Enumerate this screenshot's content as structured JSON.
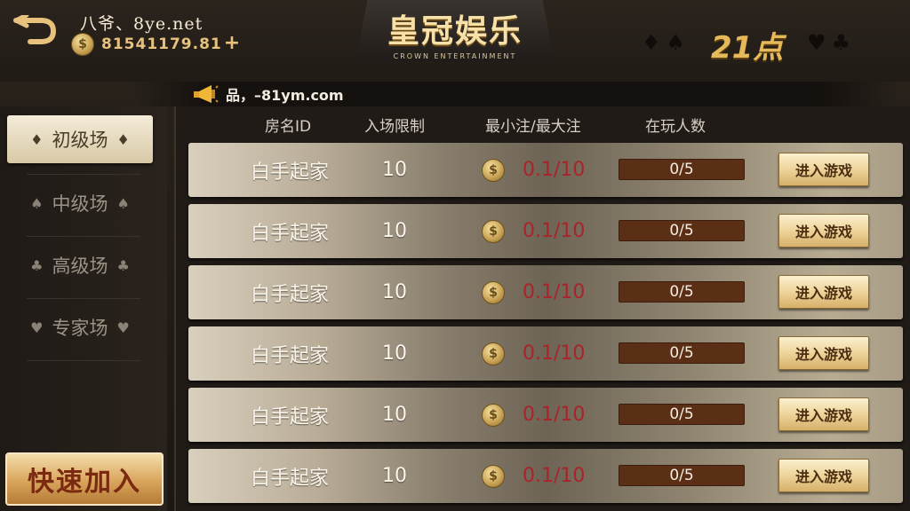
{
  "header": {
    "user_name": "八爷、8ye.net",
    "coin_amount": "81541179.81",
    "add_symbol": "+",
    "logo_title": "皇冠娱乐",
    "logo_subtitle": "CROWN ENTERTAINMENT",
    "game_name": "21点",
    "suits_left": "♦♠",
    "suits_right": "♥♣"
  },
  "notice": {
    "text": "品，–81ym.com"
  },
  "sidebar": {
    "items": [
      {
        "label": "初级场",
        "suit": "♦",
        "active": true
      },
      {
        "label": "中级场",
        "suit": "♠",
        "active": false
      },
      {
        "label": "高级场",
        "suit": "♣",
        "active": false
      },
      {
        "label": "专家场",
        "suit": "♥",
        "active": false
      }
    ],
    "quick_join": "快速加入"
  },
  "table": {
    "columns": [
      "房名ID",
      "入场限制",
      "最小注/最大注",
      "在玩人数"
    ],
    "rows": [
      {
        "name": "白手起家",
        "limit": "10",
        "bet": "0.1/10",
        "players": "0/5",
        "button": "进入游戏"
      },
      {
        "name": "白手起家",
        "limit": "10",
        "bet": "0.1/10",
        "players": "0/5",
        "button": "进入游戏"
      },
      {
        "name": "白手起家",
        "limit": "10",
        "bet": "0.1/10",
        "players": "0/5",
        "button": "进入游戏"
      },
      {
        "name": "白手起家",
        "limit": "10",
        "bet": "0.1/10",
        "players": "0/5",
        "button": "进入游戏"
      },
      {
        "name": "白手起家",
        "limit": "10",
        "bet": "0.1/10",
        "players": "0/5",
        "button": "进入游戏"
      },
      {
        "name": "白手起家",
        "limit": "10",
        "bet": "0.1/10",
        "players": "0/5",
        "button": "进入游戏"
      }
    ]
  },
  "icons": {
    "back": "back-arrow-icon",
    "coin": "gold-coin-icon",
    "speaker": "megaphone-icon"
  },
  "colors": {
    "accent": "#e5b95a",
    "bet_text": "#a8242a",
    "players_bar": "#5b2f15"
  }
}
